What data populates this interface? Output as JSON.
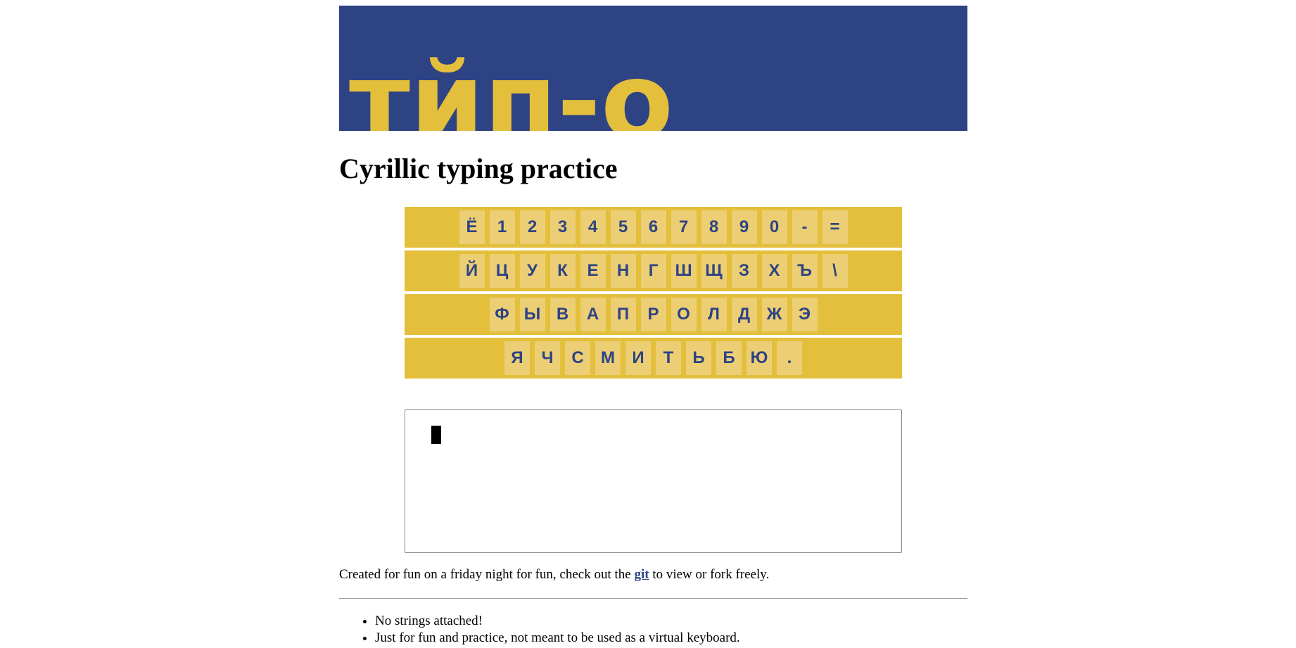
{
  "banner": {
    "logo_text": "тйп-о",
    "background": "#2e4384",
    "accent": "#e3bf3c"
  },
  "page": {
    "title": "Cyrillic typing practice"
  },
  "keyboard": {
    "rows": [
      [
        "Ё",
        "1",
        "2",
        "3",
        "4",
        "5",
        "6",
        "7",
        "8",
        "9",
        "0",
        "-",
        "="
      ],
      [
        "Й",
        "Ц",
        "У",
        "К",
        "Е",
        "Н",
        "Г",
        "Ш",
        "Щ",
        "З",
        "Х",
        "Ъ",
        "\\"
      ],
      [
        "Ф",
        "Ы",
        "В",
        "А",
        "П",
        "Р",
        "О",
        "Л",
        "Д",
        "Ж",
        "Э"
      ],
      [
        "Я",
        "Ч",
        "С",
        "М",
        "И",
        "Т",
        "Ь",
        "Б",
        "Ю",
        "."
      ]
    ],
    "row_color": "#e3bf3c",
    "key_color": "#ecce74",
    "key_text_color": "#2e4384"
  },
  "typing_area": {
    "value": ""
  },
  "footer": {
    "text_before": "Created for fun on a friday night for fun, check out the ",
    "link_label": "git",
    "text_after": " to view or fork freely."
  },
  "notes": [
    "No strings attached!",
    "Just for fun and practice, not meant to be used as a virtual keyboard."
  ]
}
